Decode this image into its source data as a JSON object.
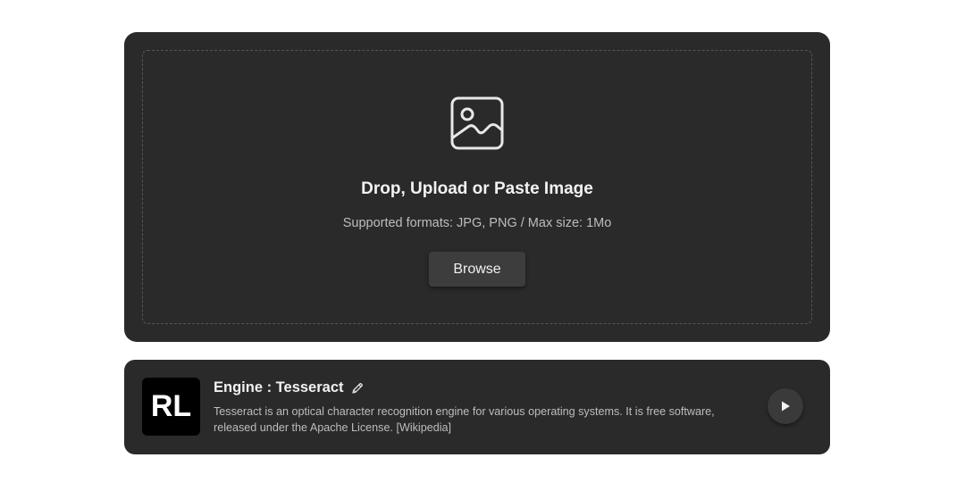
{
  "upload": {
    "icon": "image-icon",
    "title": "Drop, Upload or Paste Image",
    "formats": "Supported formats: JPG, PNG / Max size: 1Mo",
    "browse_label": "Browse"
  },
  "engine": {
    "logo_text": "RL",
    "title": "Engine : Tesseract",
    "edit_icon": "pencil-icon",
    "description": "Tesseract is an optical character recognition engine for various operating systems. It is free software, released under the Apache License.",
    "link_text": "[Wikipedia]",
    "play_icon": "play-icon"
  },
  "colors": {
    "card_background": "#2a2a2a",
    "button_background": "#3d3d3d",
    "logo_background": "#000000",
    "text_primary": "#f2f2f2",
    "text_secondary": "#bdbdbd"
  }
}
